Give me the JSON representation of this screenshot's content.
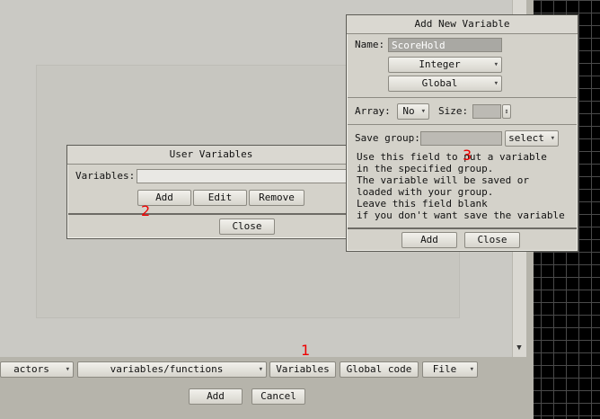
{
  "bottom_toolbar": {
    "actors": "actors",
    "variables_functions": "variables/functions",
    "variables": "Variables",
    "global_code": "Global code",
    "file": "File",
    "add": "Add",
    "cancel": "Cancel"
  },
  "user_variables": {
    "title": "User Variables",
    "variables_label": "Variables:",
    "variables_value": "",
    "add": "Add",
    "edit": "Edit",
    "remove": "Remove",
    "close": "Close"
  },
  "add_new_variable": {
    "title": "Add New Variable",
    "name_label": "Name:",
    "name_value": "ScoreHold",
    "type_value": "Integer",
    "scope_value": "Global",
    "array_label": "Array:",
    "array_value": "No",
    "size_label": "Size:",
    "size_value": "",
    "save_group_label": "Save group:",
    "save_group_value": "",
    "select": "select",
    "help_text": "Use this field to put a variable\nin the specified group.\nThe variable will be saved or\nloaded with your group.\nLeave this field blank\nif you don't want save the variable",
    "add": "Add",
    "close": "Close"
  },
  "markers": {
    "m1": "1",
    "m2": "2",
    "m3": "3"
  },
  "colors": {
    "marker": "#e00000",
    "panel": "#d4d2ca"
  }
}
